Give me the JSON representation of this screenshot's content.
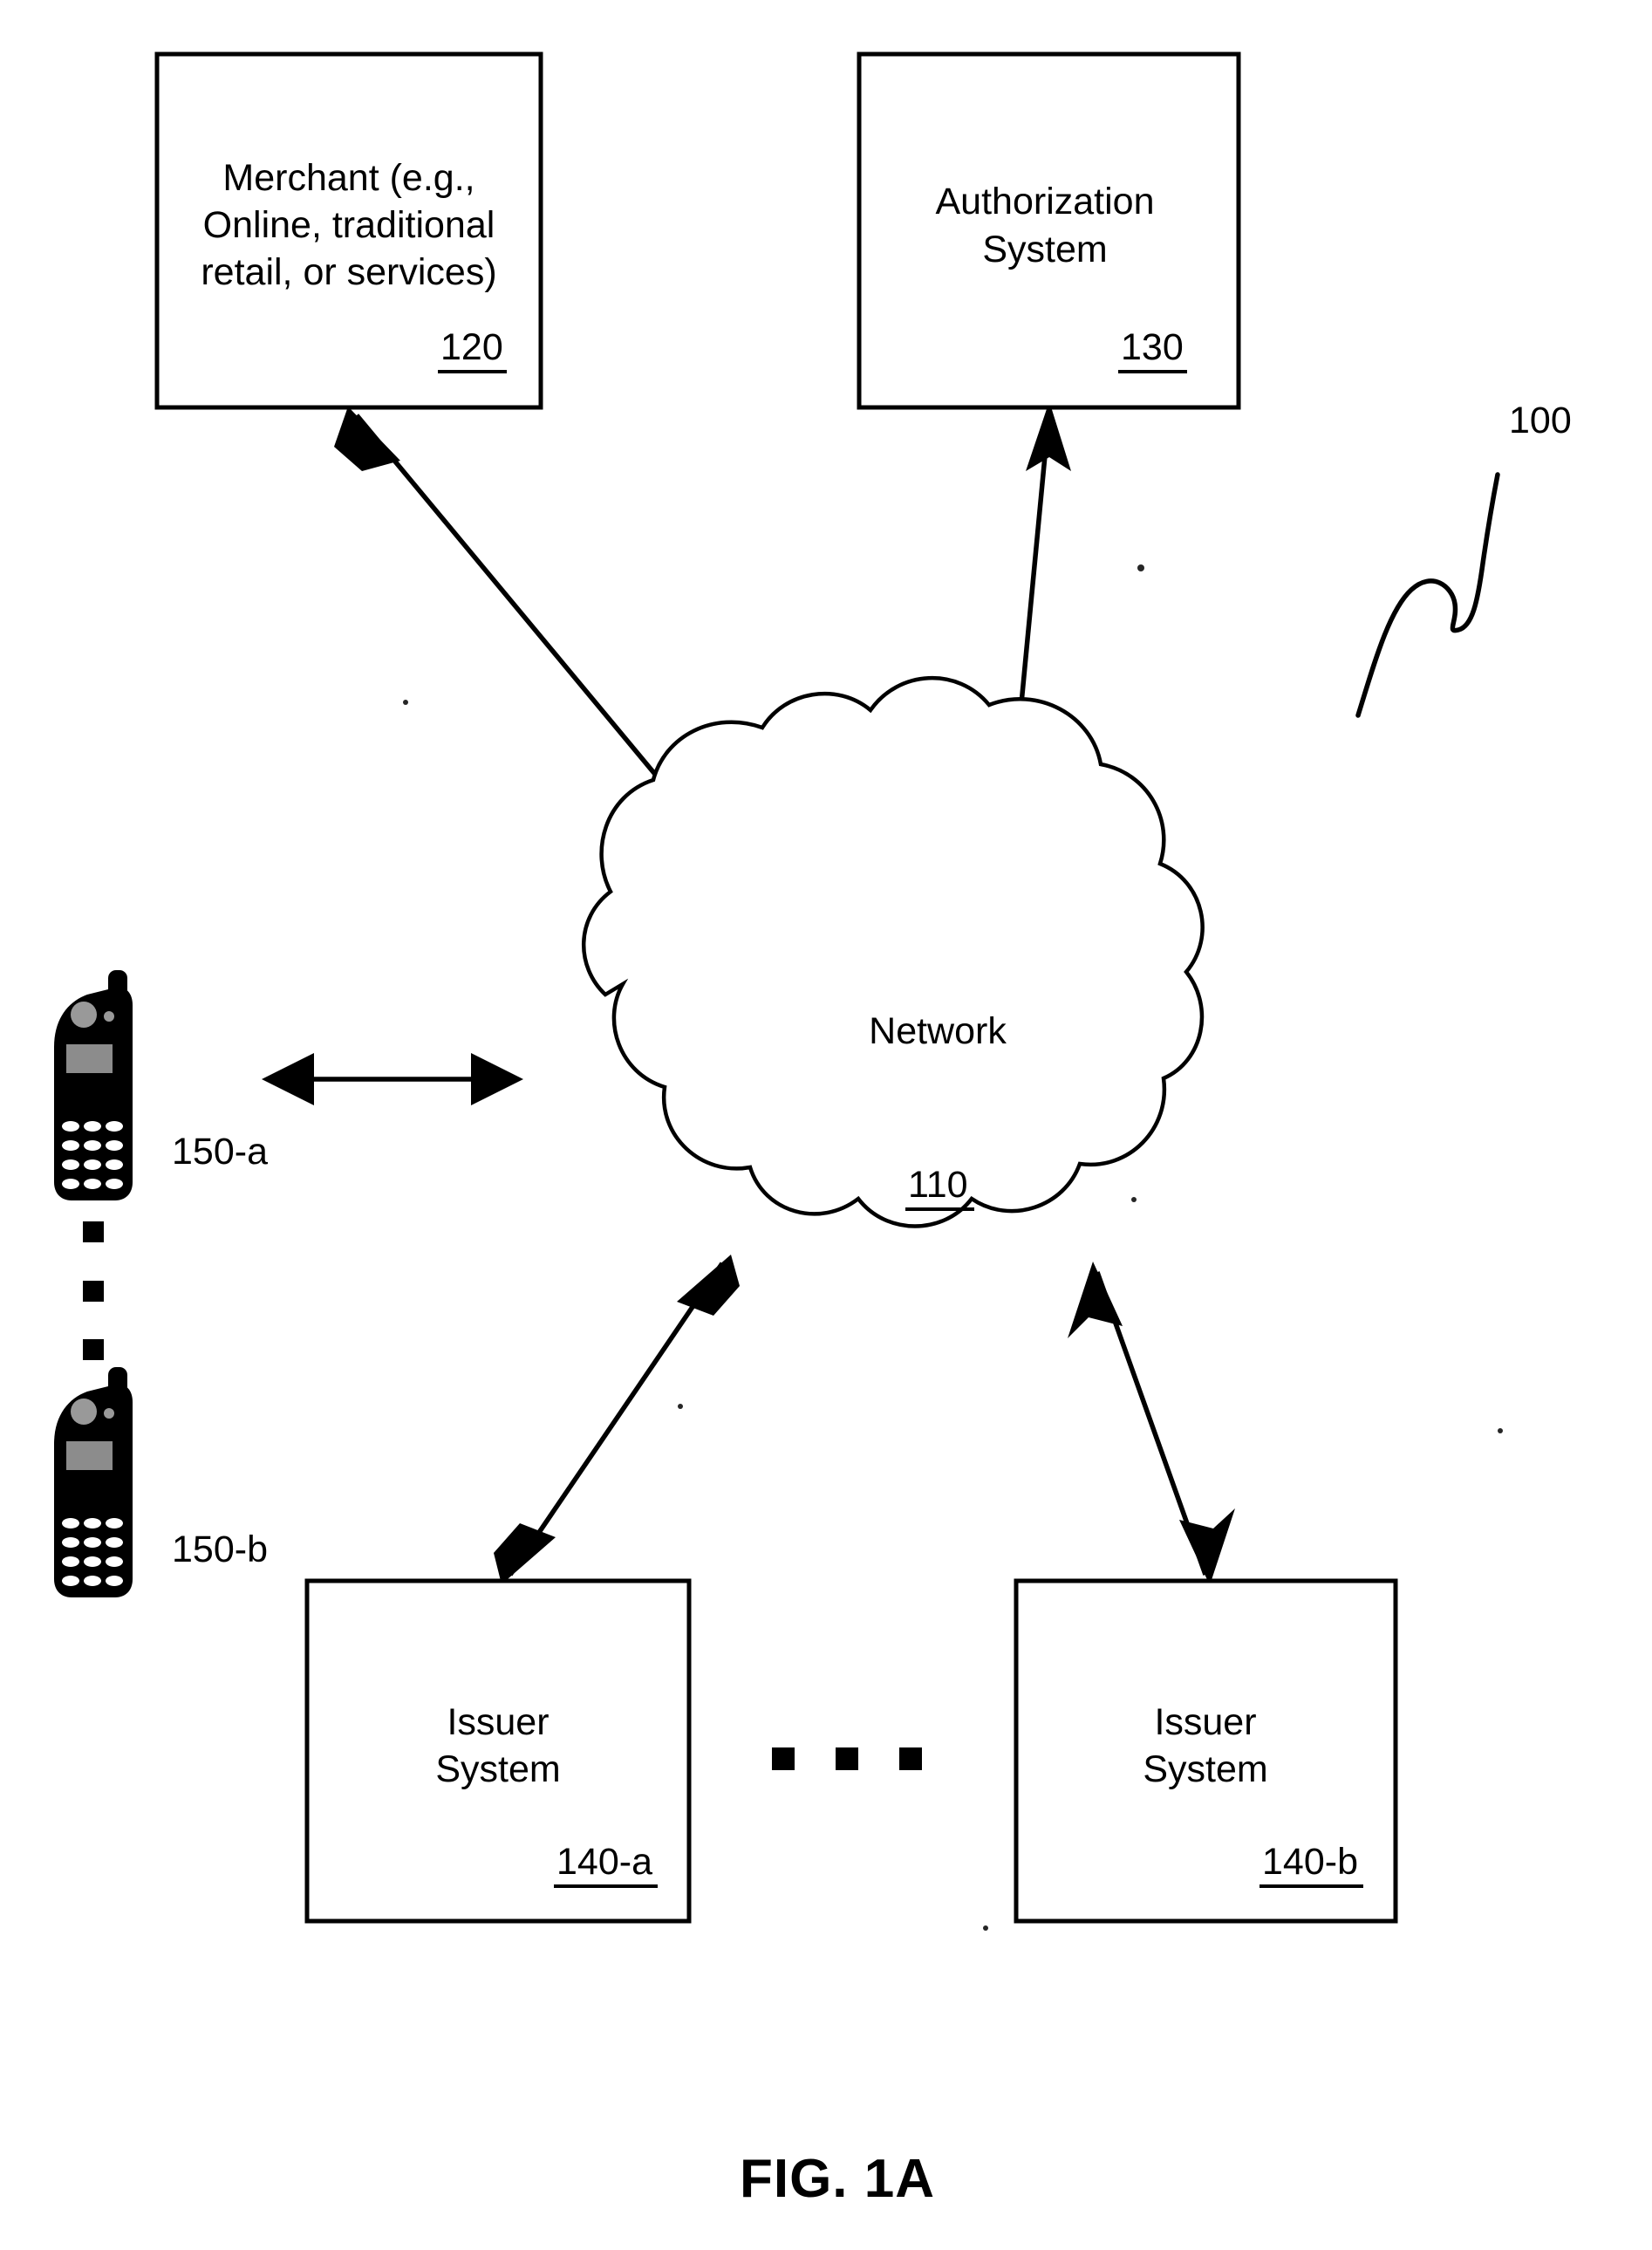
{
  "figure": {
    "caption": "FIG. 1A",
    "system_ref": "100"
  },
  "nodes": {
    "merchant": {
      "name": "merchant-box",
      "lines": [
        "Merchant (e.g.,",
        "Online, traditional",
        "retail, or services)"
      ],
      "ref": "120"
    },
    "authorization": {
      "name": "authorization-system-box",
      "lines": [
        "Authorization",
        "System"
      ],
      "ref": "130"
    },
    "network": {
      "name": "network-cloud",
      "label": "Network",
      "ref": "110"
    },
    "issuer_a": {
      "name": "issuer-system-a-box",
      "lines": [
        "Issuer",
        "System"
      ],
      "ref": "140-a"
    },
    "issuer_b": {
      "name": "issuer-system-b-box",
      "lines": [
        "Issuer",
        "System"
      ],
      "ref": "140-b"
    },
    "mobile_a": {
      "name": "mobile-device-a",
      "ref": "150-a"
    },
    "mobile_b": {
      "name": "mobile-device-b",
      "ref": "150-b"
    }
  },
  "connectors": [
    {
      "name": "merchant-to-network",
      "from": "merchant",
      "to": "network",
      "style": "double-arrow"
    },
    {
      "name": "authorization-to-network",
      "from": "authorization",
      "to": "network",
      "style": "double-arrow"
    },
    {
      "name": "mobile-to-network",
      "from": "mobile_a",
      "to": "network",
      "style": "double-arrow"
    },
    {
      "name": "network-to-issuer-a",
      "from": "network",
      "to": "issuer_a",
      "style": "double-arrow"
    },
    {
      "name": "network-to-issuer-b",
      "from": "network",
      "to": "issuer_b",
      "style": "double-arrow"
    }
  ],
  "ellipses": [
    {
      "name": "vertical-ellipsis-devices",
      "orientation": "vertical",
      "count": 3
    },
    {
      "name": "horizontal-ellipsis-issuers",
      "orientation": "horizontal",
      "count": 3
    }
  ],
  "colors": {
    "ink": "#000000",
    "paper": "#ffffff"
  }
}
